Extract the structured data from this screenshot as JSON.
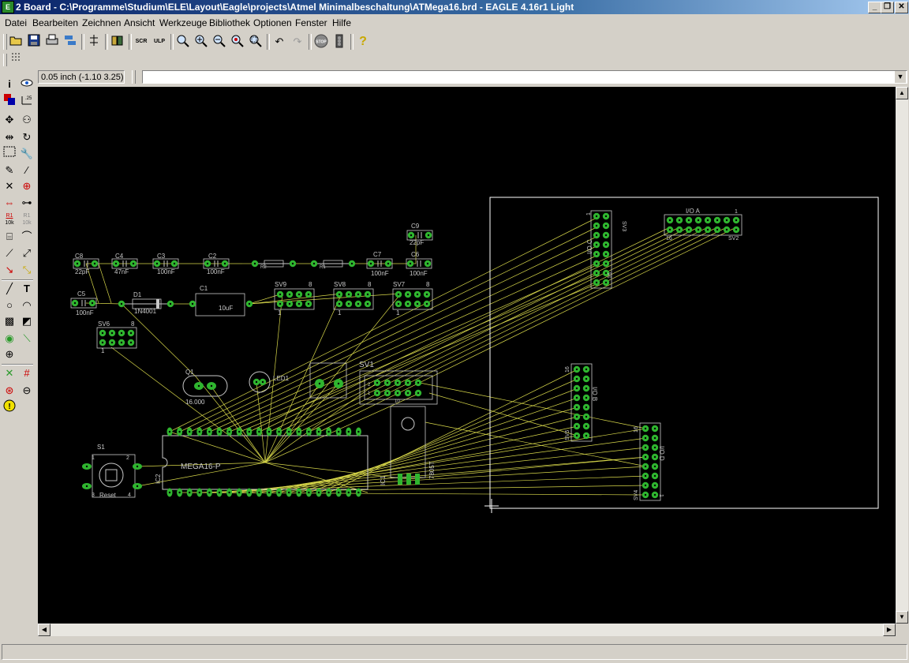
{
  "window": {
    "title": "2 Board - C:\\Programme\\Studium\\ELE\\Layout\\Eagle\\projects\\Atmel Minimalbeschaltung\\ATMega16.brd - EAGLE 4.16r1 Light",
    "minimize": "_",
    "maximize": "❐",
    "close": "✕"
  },
  "menu": [
    {
      "label": "Datei"
    },
    {
      "label": "Bearbeiten"
    },
    {
      "label": "Zeichnen"
    },
    {
      "label": "Ansicht"
    },
    {
      "label": "Werkzeuge"
    },
    {
      "label": "Bibliothek"
    },
    {
      "label": "Optionen"
    },
    {
      "label": "Fenster"
    },
    {
      "label": "Hilfe"
    }
  ],
  "toolbar": {
    "icons": [
      "open-icon",
      "save-icon",
      "print-icon",
      "cam-icon",
      "schematic-icon",
      "board-icon",
      "script-icon",
      "ulp-icon",
      "zoom-fit-icon",
      "zoom-in-icon",
      "zoom-out-icon",
      "zoom-redraw-icon",
      "zoom-select-icon",
      "undo-icon",
      "redo-icon",
      "stop-icon",
      "go-icon",
      "help-icon"
    ],
    "stop_label": "STOP",
    "scr_label": "SCR",
    "ulp_label": "ULP",
    "help_label": "?"
  },
  "coord": {
    "text": "0.05 inch (-1.10 3.25)"
  },
  "command": {
    "value": "",
    "dropdown": "▼"
  },
  "palette_labels": {
    "r_tool": "R1",
    "r_sub": "10k",
    "text_tool": "T"
  },
  "board": {
    "labels": {
      "c8": "C8",
      "c8v": "22pF",
      "c4": "C4",
      "c4v": "47nF",
      "c3": "C3",
      "c3v": "100nF",
      "c2": "C2",
      "c2v": "100nF",
      "r2": "R2",
      "r1": "R1",
      "c7": "C7",
      "c7v": "100nF",
      "c6": "C6",
      "c6v": "100nF",
      "c9": "C9",
      "c9v": "22pF",
      "c5": "C5",
      "c5v": "100nF",
      "d1": "D1",
      "d1v": "1N4001",
      "c1": "C1",
      "c1v": "10uF",
      "sv9": "SV9",
      "sv8": "SV8",
      "sv7": "SV7",
      "sv6": "SV6",
      "n8a": "8",
      "n8b": "8",
      "n8c": "8",
      "n8d": "8",
      "n1a": "1",
      "n1b": "1",
      "n1c": "1",
      "n1d": "1",
      "q1": "Q1",
      "q1v": "16.000",
      "led1": "LED1",
      "sv1": "SV1",
      "sv1_2": "2",
      "sv1_1": "1",
      "sv1_10": "10",
      "ic2": "IC2",
      "mega": "MEGA16-P",
      "s1": "S1",
      "s1_1": "1",
      "s1_2": "2",
      "s1_3": "3",
      "s1_4": "4",
      "reset": "Reset",
      "ic1": "IC1",
      "v7805": "7805T",
      "sv3": "SV3",
      "ioc": "I/O C",
      "sv3_1": "1",
      "sv3_16": "16",
      "sv2": "SV2",
      "ioa": "I/O A",
      "sv2_1": "1",
      "sv2_16": "16",
      "sv5": "SV5",
      "iob": "I/O B",
      "sv5_16": "16",
      "sv4": "SV4",
      "iod": "I/O D",
      "sv4_16": "16",
      "sv4_1": "1"
    }
  },
  "scroll": {
    "up": "▲",
    "down": "▼",
    "left": "◀",
    "right": "▶"
  },
  "status": {
    "text": ""
  },
  "colors": {
    "canvas": "#000000",
    "pad": "#2fb52f",
    "airwire": "#d8d84a",
    "silk": "#c8c8c8",
    "outline": "#ffffff"
  }
}
